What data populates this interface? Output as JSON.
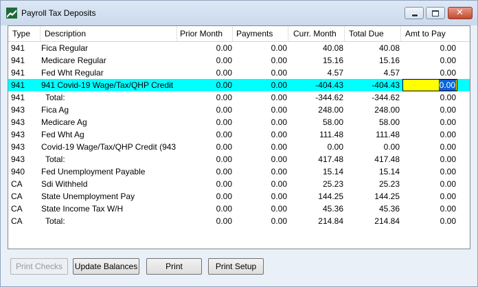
{
  "window": {
    "title": "Payroll Tax Deposits"
  },
  "columns": {
    "type": "Type",
    "description": "Description",
    "prior_month": "Prior Month",
    "payments": "Payments",
    "curr_month": "Curr. Month",
    "total_due": "Total Due",
    "amt_to_pay": "Amt to Pay"
  },
  "rows": [
    {
      "type": "941",
      "description": "Fica Regular",
      "prior": "0.00",
      "payments": "0.00",
      "curr": "40.08",
      "total": "40.08",
      "amt": "0.00"
    },
    {
      "type": "941",
      "description": "Medicare Regular",
      "prior": "0.00",
      "payments": "0.00",
      "curr": "15.16",
      "total": "15.16",
      "amt": "0.00"
    },
    {
      "type": "941",
      "description": "Fed Wht Regular",
      "prior": "0.00",
      "payments": "0.00",
      "curr": "4.57",
      "total": "4.57",
      "amt": "0.00"
    },
    {
      "type": "941",
      "description": "941 Covid-19 Wage/Tax/QHP Credit",
      "prior": "0.00",
      "payments": "0.00",
      "curr": "-404.43",
      "total": "-404.43",
      "amt": "0.00"
    },
    {
      "type": "941",
      "description": "Total:",
      "prior": "0.00",
      "payments": "0.00",
      "curr": "-344.62",
      "total": "-344.62",
      "amt": "0.00"
    },
    {
      "type": "943",
      "description": "Fica Ag",
      "prior": "0.00",
      "payments": "0.00",
      "curr": "248.00",
      "total": "248.00",
      "amt": "0.00"
    },
    {
      "type": "943",
      "description": "Medicare Ag",
      "prior": "0.00",
      "payments": "0.00",
      "curr": "58.00",
      "total": "58.00",
      "amt": "0.00"
    },
    {
      "type": "943",
      "description": "Fed Wht Ag",
      "prior": "0.00",
      "payments": "0.00",
      "curr": "111.48",
      "total": "111.48",
      "amt": "0.00"
    },
    {
      "type": "943",
      "description": "Covid-19 Wage/Tax/QHP Credit (943",
      "prior": "0.00",
      "payments": "0.00",
      "curr": "0.00",
      "total": "0.00",
      "amt": "0.00"
    },
    {
      "type": "943",
      "description": "Total:",
      "prior": "0.00",
      "payments": "0.00",
      "curr": "417.48",
      "total": "417.48",
      "amt": "0.00"
    },
    {
      "type": "940",
      "description": "Fed Unemployment Payable",
      "prior": "0.00",
      "payments": "0.00",
      "curr": "15.14",
      "total": "15.14",
      "amt": "0.00"
    },
    {
      "type": "CA",
      "description": "Sdi Withheld",
      "prior": "0.00",
      "payments": "0.00",
      "curr": "25.23",
      "total": "25.23",
      "amt": "0.00"
    },
    {
      "type": "CA",
      "description": "State Unemployment Pay",
      "prior": "0.00",
      "payments": "0.00",
      "curr": "144.25",
      "total": "144.25",
      "amt": "0.00"
    },
    {
      "type": "CA",
      "description": "State Income Tax W/H",
      "prior": "0.00",
      "payments": "0.00",
      "curr": "45.36",
      "total": "45.36",
      "amt": "0.00"
    },
    {
      "type": "CA",
      "description": "Total:",
      "prior": "0.00",
      "payments": "0.00",
      "curr": "214.84",
      "total": "214.84",
      "amt": "0.00"
    }
  ],
  "selected_row_index": 3,
  "colors": {
    "selected_row": "#00ffff",
    "edit_cell": "#ffff00",
    "text_highlight": "#0a64d8"
  },
  "buttons": {
    "print_checks": "Print Checks",
    "update_balances": "Update Balances",
    "print": "Print",
    "print_setup": "Print Setup"
  }
}
